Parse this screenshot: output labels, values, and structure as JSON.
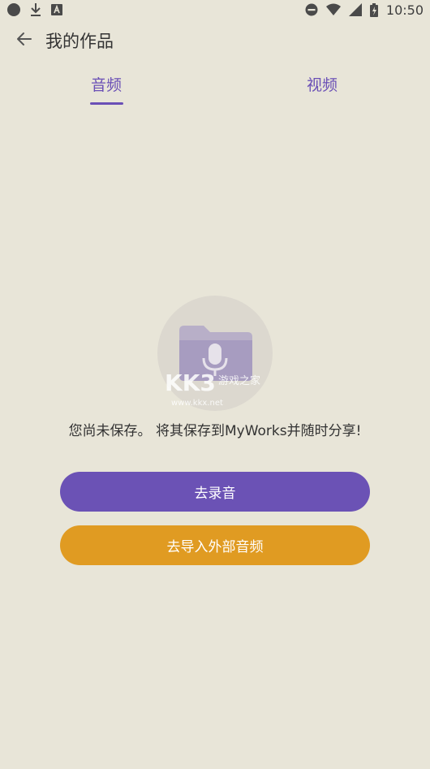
{
  "status_bar": {
    "time": "10:50",
    "left_icons": [
      "notification-dot-icon",
      "download-icon",
      "text-box-icon"
    ],
    "right_icons": [
      "do-not-disturb-icon",
      "wifi-icon",
      "signal-icon",
      "battery-charging-icon"
    ]
  },
  "header": {
    "title": "我的作品",
    "back_icon": "arrow-left-icon"
  },
  "tabs": [
    {
      "label": "音频",
      "selected": true
    },
    {
      "label": "视频",
      "selected": false
    }
  ],
  "empty_state": {
    "illustration_icon": "folder-microphone-icon",
    "watermark": "KKX 游戏之家 www.kkx.net",
    "message": "您尚未保存。 将其保存到MyWorks并随时分享!"
  },
  "actions": {
    "record_label": "去录音",
    "import_label": "去导入外部音频"
  },
  "colors": {
    "background": "#e8e5d8",
    "accent": "#6b52b5",
    "import_button": "#e09b22"
  }
}
